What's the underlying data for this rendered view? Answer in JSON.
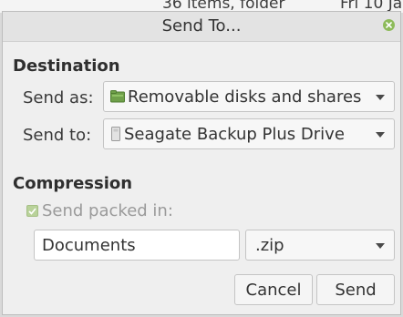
{
  "background_window": {
    "items_text": "36 items, folder",
    "date_text": "Fri 10 Ja"
  },
  "dialog": {
    "title": "Send To..."
  },
  "destination": {
    "heading": "Destination",
    "send_as_label": "Send as:",
    "send_as_value": "Removable disks and shares",
    "send_as_icon": "drive-folder-icon",
    "send_to_label": "Send to:",
    "send_to_value": "Seagate Backup Plus Drive",
    "send_to_icon": "usb-drive-icon"
  },
  "compression": {
    "heading": "Compression",
    "send_packed_label": "Send packed in:",
    "send_packed_checked": true,
    "archive_name": "Documents",
    "archive_format": ".zip"
  },
  "buttons": {
    "cancel": "Cancel",
    "send": "Send"
  },
  "colors": {
    "accent_green": "#8dbb5a",
    "dialog_background": "#efefef"
  }
}
